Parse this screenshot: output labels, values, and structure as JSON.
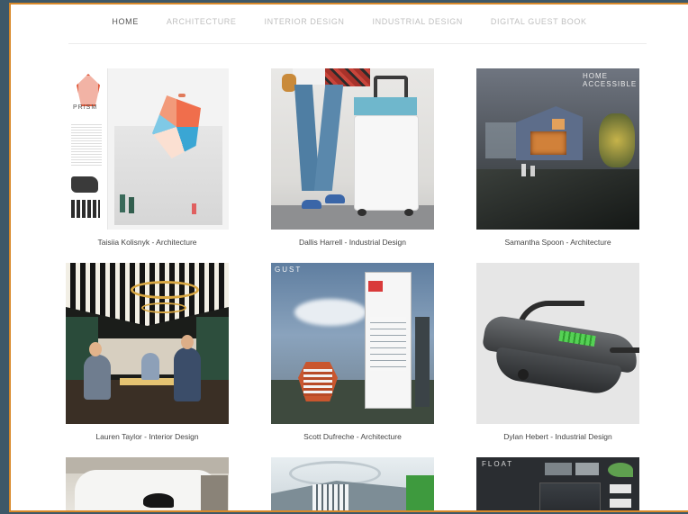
{
  "nav": {
    "items": [
      {
        "label": "HOME",
        "active": true
      },
      {
        "label": "ARCHITECTURE",
        "active": false
      },
      {
        "label": "INTERIOR DESIGN",
        "active": false
      },
      {
        "label": "INDUSTRIAL DESIGN",
        "active": false
      },
      {
        "label": "DIGITAL GUEST BOOK",
        "active": false
      }
    ]
  },
  "gallery": {
    "items": [
      {
        "caption": "Taisiia Kolisnyk - Architecture",
        "art_label": "PRISM"
      },
      {
        "caption": "Dallis Harrell - Industrial Design"
      },
      {
        "caption": "Samantha Spoon - Architecture",
        "art_label": "HOME ACCESSIBLE"
      },
      {
        "caption": "Lauren Taylor - Interior Design"
      },
      {
        "caption": "Scott Dufreche - Architecture",
        "art_label": "GUST"
      },
      {
        "caption": "Dylan Hebert - Industrial Design"
      },
      {
        "caption": ""
      },
      {
        "caption": ""
      },
      {
        "caption": "",
        "art_label": "FLOAT"
      }
    ]
  },
  "colors": {
    "frame_border": "#d9892a",
    "background": "#3e5868",
    "nav_active": "#555555",
    "nav_inactive": "#bfbfbf"
  }
}
